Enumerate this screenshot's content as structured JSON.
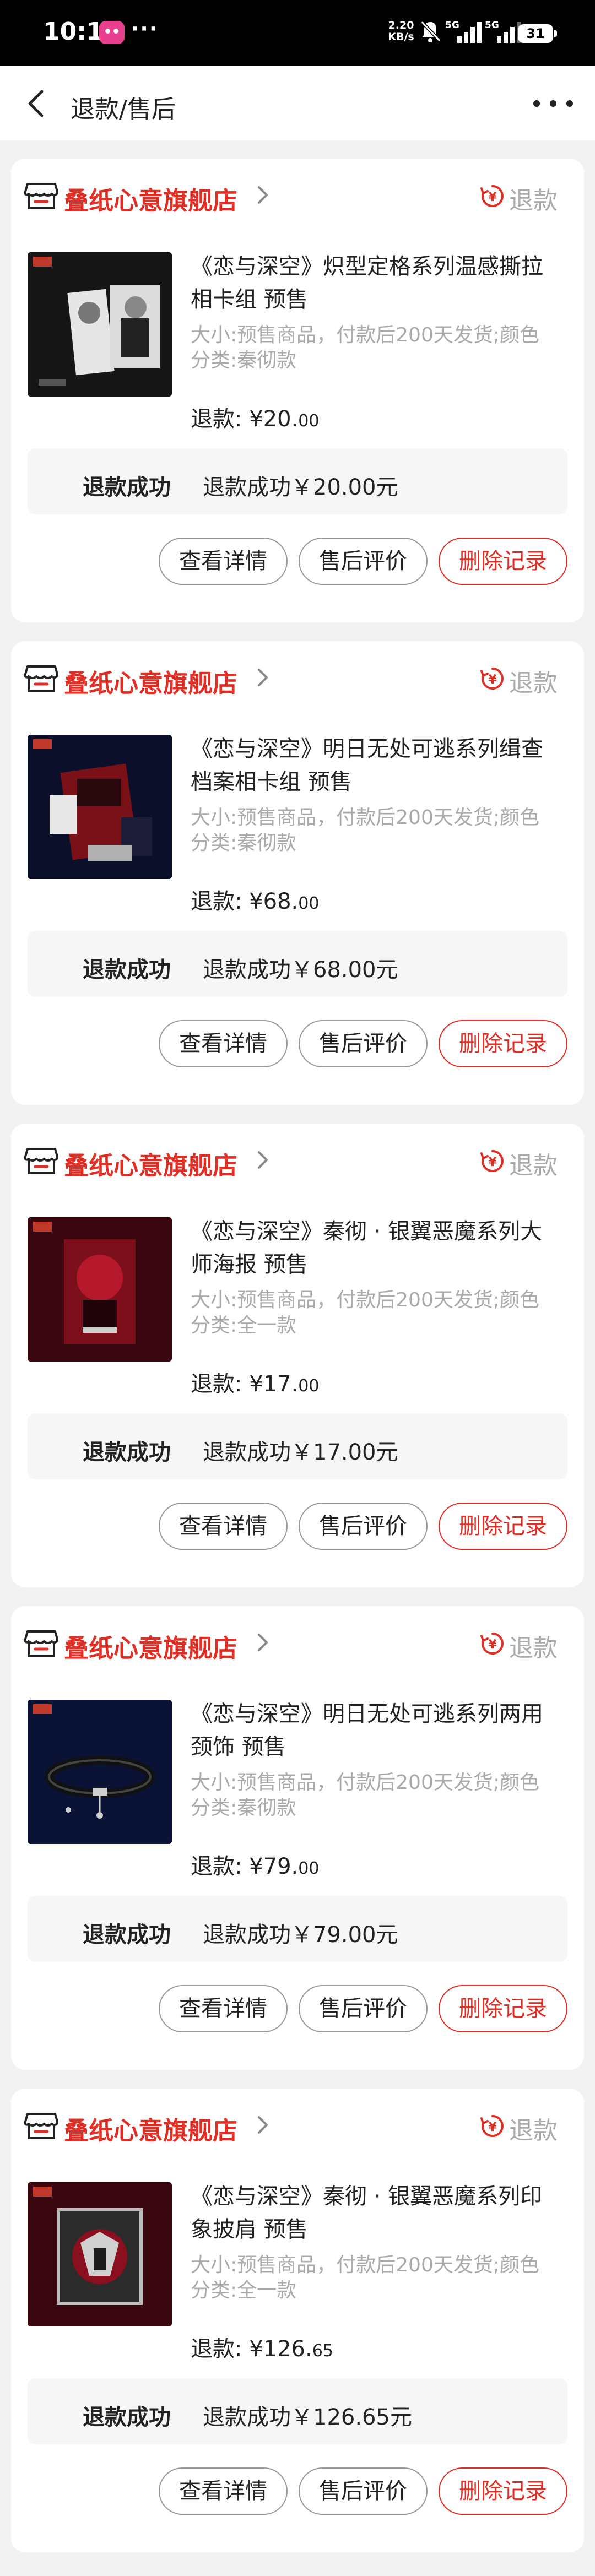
{
  "status_bar": {
    "time": "10:17",
    "more": "···",
    "net_speed_value": "2.20",
    "net_speed_unit": "KB/s",
    "sim1": "5G",
    "sim2": "5G",
    "battery": "31"
  },
  "nav": {
    "title": "退款/售后"
  },
  "colors": {
    "accent": "#e02e24",
    "muted_text": "#aaaaaa",
    "background": "#f2f2f2"
  },
  "orders": [
    {
      "store": "叠纸心意旗舰店",
      "refund_tag": "退款",
      "title": "《恋与深空》炽型定格系列温感撕拉相卡组 预售",
      "specs": "大小:预售商品，付款后200天发货;颜色分类:秦彻款",
      "amount_label": "退款: ¥",
      "amount_int": "20.",
      "amount_dec": "00",
      "status_label": "退款成功",
      "status_detail": "退款成功￥20.00元",
      "btn_detail": "查看详情",
      "btn_review": "售后评价",
      "btn_delete": "删除记录"
    },
    {
      "store": "叠纸心意旗舰店",
      "refund_tag": "退款",
      "title": "《恋与深空》明日无处可逃系列缉查档案相卡组 预售",
      "specs": "大小:预售商品，付款后200天发货;颜色分类:秦彻款",
      "amount_label": "退款: ¥",
      "amount_int": "68.",
      "amount_dec": "00",
      "status_label": "退款成功",
      "status_detail": "退款成功￥68.00元",
      "btn_detail": "查看详情",
      "btn_review": "售后评价",
      "btn_delete": "删除记录"
    },
    {
      "store": "叠纸心意旗舰店",
      "refund_tag": "退款",
      "title": "《恋与深空》秦彻 · 银翼恶魔系列大师海报 预售",
      "specs": "大小:预售商品，付款后200天发货;颜色分类:全一款",
      "amount_label": "退款: ¥",
      "amount_int": "17.",
      "amount_dec": "00",
      "status_label": "退款成功",
      "status_detail": "退款成功￥17.00元",
      "btn_detail": "查看详情",
      "btn_review": "售后评价",
      "btn_delete": "删除记录"
    },
    {
      "store": "叠纸心意旗舰店",
      "refund_tag": "退款",
      "title": "《恋与深空》明日无处可逃系列两用颈饰 预售",
      "specs": "大小:预售商品，付款后200天发货;颜色分类:秦彻款",
      "amount_label": "退款: ¥",
      "amount_int": "79.",
      "amount_dec": "00",
      "status_label": "退款成功",
      "status_detail": "退款成功￥79.00元",
      "btn_detail": "查看详情",
      "btn_review": "售后评价",
      "btn_delete": "删除记录"
    },
    {
      "store": "叠纸心意旗舰店",
      "refund_tag": "退款",
      "title": "《恋与深空》秦彻 · 银翼恶魔系列印象披肩 预售",
      "specs": "大小:预售商品，付款后200天发货;颜色分类:全一款",
      "amount_label": "退款: ¥",
      "amount_int": "126.",
      "amount_dec": "65",
      "status_label": "退款成功",
      "status_detail": "退款成功￥126.65元",
      "btn_detail": "查看详情",
      "btn_review": "售后评价",
      "btn_delete": "删除记录"
    }
  ]
}
